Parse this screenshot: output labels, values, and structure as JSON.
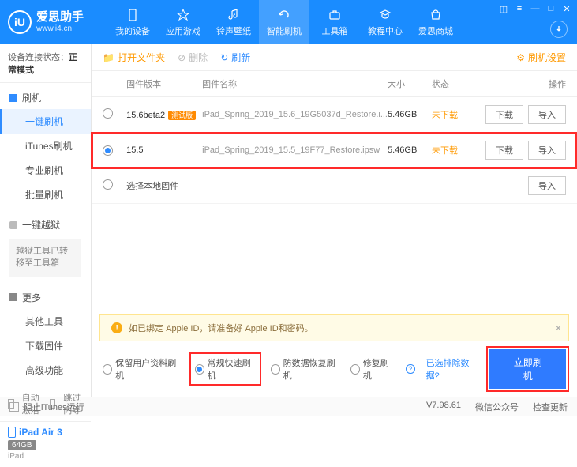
{
  "brand": {
    "title": "爱思助手",
    "url": "www.i4.cn",
    "logo_letter": "iU"
  },
  "nav": {
    "items": [
      {
        "label": "我的设备"
      },
      {
        "label": "应用游戏"
      },
      {
        "label": "铃声壁纸"
      },
      {
        "label": "智能刷机"
      },
      {
        "label": "工具箱"
      },
      {
        "label": "教程中心"
      },
      {
        "label": "爱思商城"
      }
    ],
    "active_index": 3
  },
  "sidebar": {
    "conn_prefix": "设备连接状态：",
    "conn_value": "正常模式",
    "groups": {
      "flash": {
        "head": "刷机",
        "items": [
          "一键刷机",
          "iTunes刷机",
          "专业刷机",
          "批量刷机"
        ],
        "active_index": 0
      },
      "jailbreak": {
        "head": "一键越狱",
        "note": "越狱工具已转移至工具箱"
      },
      "more": {
        "head": "更多",
        "items": [
          "其他工具",
          "下载固件",
          "高级功能"
        ]
      }
    },
    "bottom": {
      "auto_activate": "自动激活",
      "skip_guide": "跳过向导"
    },
    "device": {
      "name": "iPad Air 3",
      "storage": "64GB",
      "type": "iPad"
    }
  },
  "toolbar": {
    "open_folder": "打开文件夹",
    "delete": "删除",
    "refresh": "刷新",
    "settings": "刷机设置"
  },
  "table": {
    "headers": {
      "version": "固件版本",
      "name": "固件名称",
      "size": "大小",
      "status": "状态",
      "ops": "操作"
    },
    "rows": [
      {
        "version": "15.6beta2",
        "beta_label": "测试版",
        "name": "iPad_Spring_2019_15.6_19G5037d_Restore.i...",
        "size": "5.46GB",
        "status": "未下载",
        "selected": false
      },
      {
        "version": "15.5",
        "name": "iPad_Spring_2019_15.5_19F77_Restore.ipsw",
        "size": "5.46GB",
        "status": "未下载",
        "selected": true
      }
    ],
    "local_row": "选择本地固件",
    "btn_download": "下载",
    "btn_import": "导入"
  },
  "warning": {
    "text": "如已绑定 Apple ID，请准备好 Apple ID和密码。"
  },
  "options": {
    "keep_data": "保留用户资料刷机",
    "normal_fast": "常规快速刷机",
    "anti_recovery": "防数据恢复刷机",
    "repair": "修复刷机",
    "exclude_link": "已选排除数据?",
    "flash_now": "立即刷机",
    "selected": "normal_fast"
  },
  "statusbar": {
    "block_itunes": "阻止iTunes运行",
    "version": "V7.98.61",
    "wechat": "微信公众号",
    "check_update": "检查更新"
  }
}
